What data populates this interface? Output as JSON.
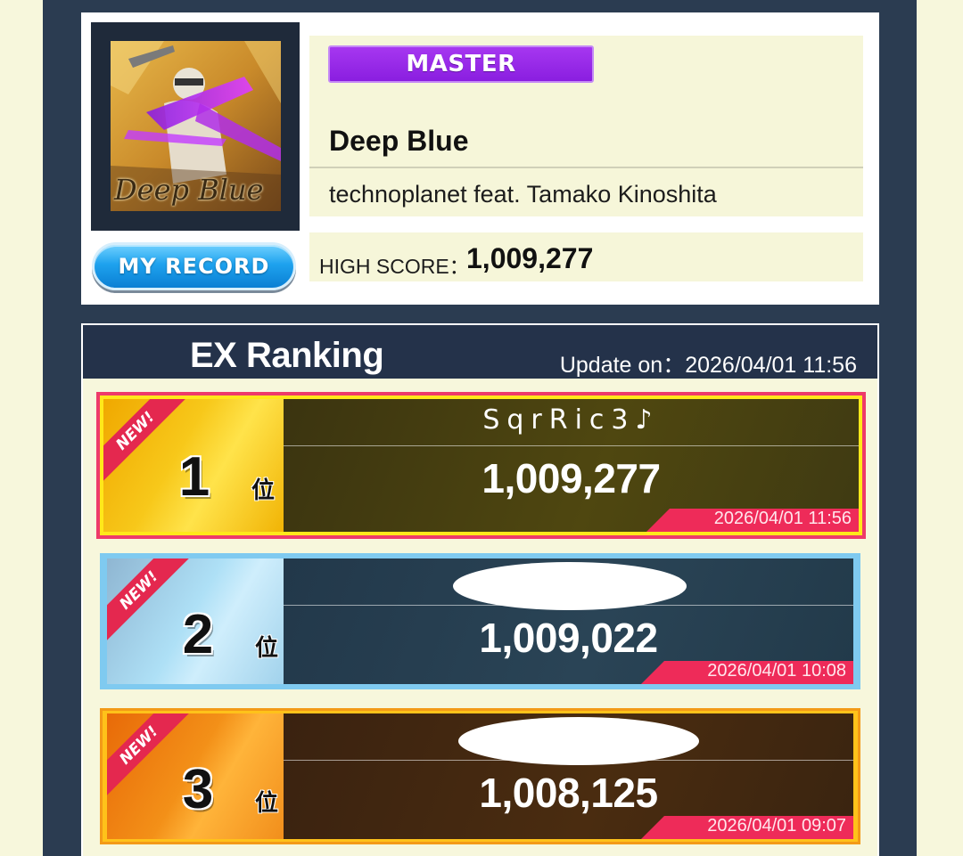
{
  "song": {
    "difficulty": "MASTER",
    "title": "Deep Blue",
    "artist": "technoplanet feat. Tamako Kinoshita",
    "jacket_text": "Deep Blue",
    "high_score_label": "HIGH SCORE：",
    "high_score": "1,009,277",
    "my_record_label": "MY RECORD"
  },
  "ranking": {
    "title": "EX Ranking",
    "update_label": "Update on：2026/04/01 11:56",
    "entries": [
      {
        "rank": "1",
        "suffix": "位",
        "new": "NEW!",
        "name": "SqrRic3♪",
        "score": "1,009,277",
        "date": "2026/04/01 11:56",
        "redacted": false
      },
      {
        "rank": "2",
        "suffix": "位",
        "new": "NEW!",
        "name": "",
        "score": "1,009,022",
        "date": "2026/04/01 10:08",
        "redacted": true
      },
      {
        "rank": "3",
        "suffix": "位",
        "new": "NEW!",
        "name": "",
        "score": "1,008,125",
        "date": "2026/04/01 09:07",
        "redacted": true
      }
    ]
  },
  "colors": {
    "page_bg": "#f7f7dc",
    "frame": "#2b3c51",
    "master_purple": "#9a2ae8",
    "gold": "#f5c518",
    "silver_blue": "#7fcaf0",
    "bronze": "#f08a18",
    "date_strip": "#ee2b59"
  }
}
